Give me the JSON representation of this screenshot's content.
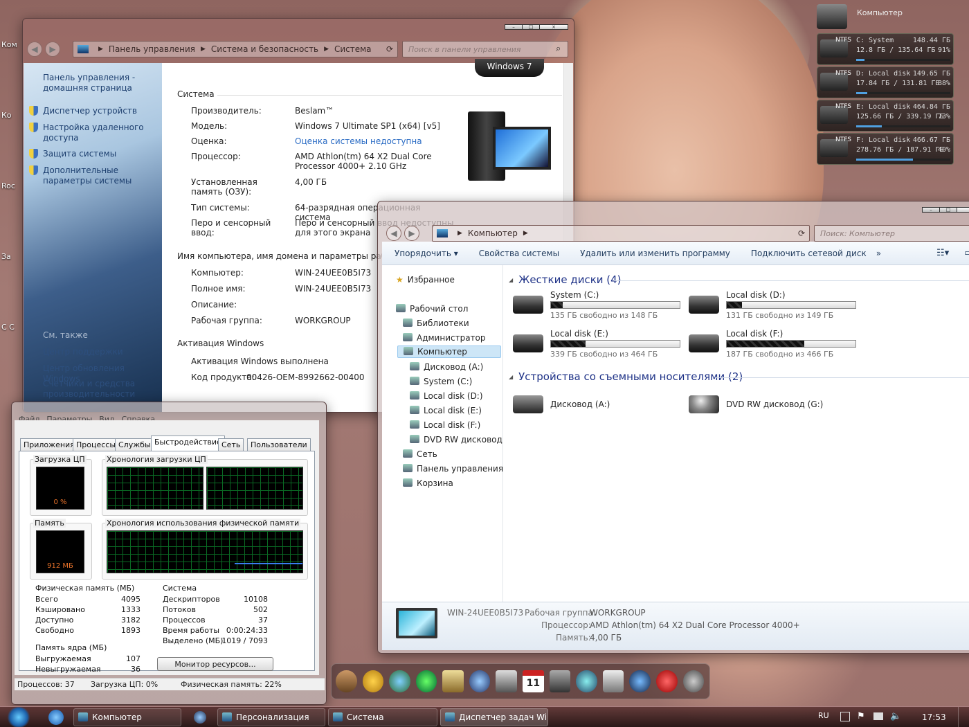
{
  "desktop": {
    "icons": [
      "Ком",
      "Ко",
      "Roc",
      "За",
      "С С"
    ]
  },
  "gadget": {
    "title": "Компьютер",
    "drives": [
      {
        "fs": "NTFS",
        "name": "C: System",
        "total": "148.44 ГБ",
        "used": "12.8 ГБ / 135.64 ГБ",
        "pct": "91%",
        "fill": 0.09
      },
      {
        "fs": "NTFS",
        "name": "D: Local disk",
        "total": "149.65 ГБ",
        "used": "17.84 ГБ / 131.81 ГБ",
        "pct": "88%",
        "fill": 0.12
      },
      {
        "fs": "NTFS",
        "name": "E: Local disk",
        "total": "464.84 ГБ",
        "used": "125.66 ГБ / 339.19 ГБ",
        "pct": "73%",
        "fill": 0.27
      },
      {
        "fs": "NTFS",
        "name": "F: Local disk",
        "total": "466.67 ГБ",
        "used": "278.76 ГБ / 187.91 ГБ",
        "pct": "40%",
        "fill": 0.6
      }
    ]
  },
  "control_panel": {
    "breadcrumb": [
      "Панель управления",
      "Система и безопасность",
      "Система"
    ],
    "search_placeholder": "Поиск в панели управления",
    "sidebar": {
      "home": "Панель управления - домашняя страница",
      "links": [
        "Диспетчер устройств",
        "Настройка удаленного доступа",
        "Защита системы",
        "Дополнительные параметры системы"
      ],
      "see_also": "См. также",
      "see_also_links": [
        "Центр поддержки",
        "Центр обновления Windows",
        "Счетчики и средства производительности"
      ]
    },
    "logo": "Windows 7",
    "system_heading": "Система",
    "system_rows": [
      {
        "label": "Производитель:",
        "value": "Beslam™"
      },
      {
        "label": "Модель:",
        "value": "Windows 7 Ultimate SP1 (x64) [v5]"
      },
      {
        "label": "Оценка:",
        "value": "Оценка системы недоступна"
      },
      {
        "label": "Процессор:",
        "value": "AMD Athlon(tm) 64 X2 Dual Core Processor 4000+   2.10 GHz"
      },
      {
        "label": "Установленная память (ОЗУ):",
        "value": "4,00 ГБ"
      },
      {
        "label": "Тип системы:",
        "value": "64-разрядная операционная система"
      },
      {
        "label": "Перо и сенсорный ввод:",
        "value": "Перо и сенсорный ввод недоступны для этого экрана"
      }
    ],
    "computer_heading": "Имя компьютера, имя домена и параметры рабочей группы",
    "computer_rows": [
      {
        "label": "Компьютер:",
        "value": "WIN-24UEE0B5I73"
      },
      {
        "label": "Полное имя:",
        "value": "WIN-24UEE0B5I73"
      },
      {
        "label": "Описание:",
        "value": ""
      },
      {
        "label": "Рабочая группа:",
        "value": "WORKGROUP"
      }
    ],
    "activation_heading": "Активация Windows",
    "activation_status": "Активация Windows выполнена",
    "product_label": "Код продукта:",
    "product_code": "00426-OEM-8992662-00400"
  },
  "explorer": {
    "breadcrumb": "Компьютер",
    "search_placeholder": "Поиск: Компьютер",
    "toolbar": [
      "Упорядочить ▾",
      "Свойства системы",
      "Удалить или изменить программу",
      "Подключить сетевой диск",
      "»"
    ],
    "nav": [
      "Избранное",
      "Рабочий стол",
      "Библиотеки",
      "Администратор",
      "Компьютер",
      "Дисковод (A:)",
      "System (C:)",
      "Local disk (D:)",
      "Local disk (E:)",
      "Local disk (F:)",
      "DVD RW дисковод (G:)",
      "Сеть",
      "Панель управления",
      "Корзина"
    ],
    "hdd_group": "Жесткие диски (4)",
    "drives": [
      {
        "name": "System (C:)",
        "free": "135 ГБ свободно из 148 ГБ",
        "used": 0.09
      },
      {
        "name": "Local disk (D:)",
        "free": "131 ГБ свободно из 149 ГБ",
        "used": 0.12
      },
      {
        "name": "Local disk (E:)",
        "free": "339 ГБ свободно из 464 ГБ",
        "used": 0.27
      },
      {
        "name": "Local disk (F:)",
        "free": "187 ГБ свободно из 466 ГБ",
        "used": 0.6
      }
    ],
    "removable_group": "Устройства со съемными носителями (2)",
    "removable": [
      "Дисковод (A:)",
      "DVD RW дисковод (G:)"
    ],
    "details": {
      "computer": "WIN-24UEE0B5I73",
      "workgroup_label": "Рабочая группа:",
      "workgroup": "WORKGROUP",
      "cpu_label": "Процессор:",
      "cpu": "AMD Athlon(tm) 64 X2 Dual Core Processor 4000+",
      "mem_label": "Память:",
      "mem": "4,00 ГБ"
    }
  },
  "task_manager": {
    "menu": [
      "Файл",
      "Параметры",
      "Вид",
      "Справка"
    ],
    "tabs": [
      "Приложения",
      "Процессы",
      "Службы",
      "Быстродействие",
      "Сеть",
      "Пользователи"
    ],
    "cpu_label": "Загрузка ЦП",
    "cpu_value": "0 %",
    "cpu_history_label": "Хронология загрузки ЦП",
    "mem_label": "Память",
    "mem_value": "912 МБ",
    "mem_history_label": "Хронология использования физической памяти",
    "phys": {
      "title": "Физическая память (МБ)",
      "rows": [
        [
          "Всего",
          "4095"
        ],
        [
          "Кэшировано",
          "1333"
        ],
        [
          "Доступно",
          "3182"
        ],
        [
          "Свободно",
          "1893"
        ]
      ]
    },
    "kernel": {
      "title": "Память ядра (МБ)",
      "rows": [
        [
          "Выгружаемая",
          "107"
        ],
        [
          "Невыгружаемая",
          "36"
        ]
      ]
    },
    "system": {
      "title": "Система",
      "rows": [
        [
          "Дескрипторов",
          "10108"
        ],
        [
          "Потоков",
          "502"
        ],
        [
          "Процессов",
          "37"
        ],
        [
          "Время работы",
          "0:00:24:33"
        ],
        [
          "Выделено (МБ)",
          "1019 / 7093"
        ]
      ]
    },
    "monitor_button": "Монитор ресурсов...",
    "status": {
      "processes": "Процессов: 37",
      "cpu": "Загрузка ЦП: 0%",
      "mem": "Физическая память: 22%"
    }
  },
  "taskbar": {
    "buttons": [
      "Компьютер",
      "Персонализация",
      "Система",
      "Диспетчер задач Wi..."
    ],
    "lang": "RU",
    "time": "17:53"
  },
  "dock": {
    "calendar_day": "11"
  }
}
